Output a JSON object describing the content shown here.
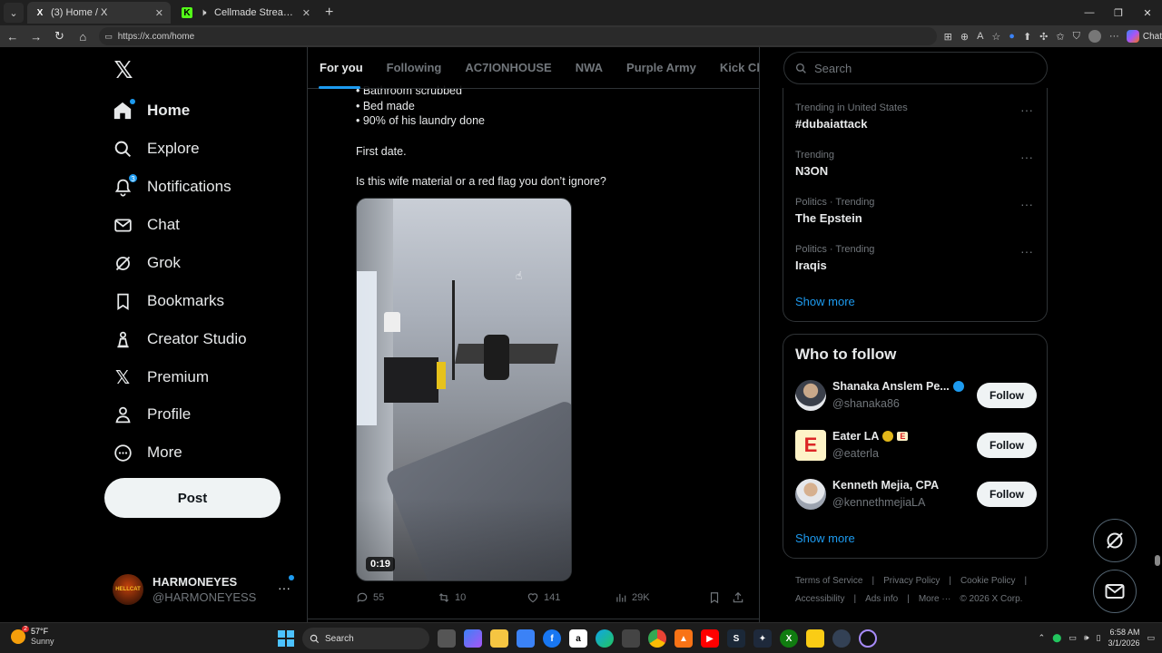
{
  "browser": {
    "tabs": [
      {
        "title": "(3) Home / X",
        "favicon": "X",
        "active": true
      },
      {
        "title": "Cellmade Stream - Watch Liv",
        "favicon": "K",
        "active": false
      }
    ],
    "url": "https://x.com/home",
    "chat_label": "Chat"
  },
  "sidebar": {
    "items": [
      {
        "label": "Home",
        "icon": "home-icon"
      },
      {
        "label": "Explore",
        "icon": "search-icon"
      },
      {
        "label": "Notifications",
        "icon": "bell-icon",
        "badge": "3"
      },
      {
        "label": "Chat",
        "icon": "mail-icon"
      },
      {
        "label": "Grok",
        "icon": "grok-icon"
      },
      {
        "label": "Bookmarks",
        "icon": "bookmark-icon"
      },
      {
        "label": "Creator Studio",
        "icon": "creator-studio-icon"
      },
      {
        "label": "Premium",
        "icon": "x-premium-icon"
      },
      {
        "label": "Profile",
        "icon": "person-icon"
      },
      {
        "label": "More",
        "icon": "more-circle-icon"
      }
    ],
    "post_label": "Post",
    "account": {
      "name": "HARMONEYES",
      "handle": "@HARMONEYESS",
      "avatar_text": "HELLCAT"
    }
  },
  "feed": {
    "tabs": [
      "For you",
      "Following",
      "AC7IONHOUSE",
      "NWA",
      "Purple Army",
      "Kick Clips"
    ],
    "post": {
      "lines": [
        "• Bathroom scrubbed",
        "• Bed made",
        "• 90% of his laundry done"
      ],
      "para1": "First date.",
      "para2": "Is this wife material or a red flag you don’t ignore?",
      "video_duration": "0:19",
      "replies": "55",
      "reposts": "10",
      "likes": "141",
      "views": "29K"
    }
  },
  "right": {
    "search_placeholder": "Search",
    "trends": [
      {
        "context": "Trending in United States",
        "title": "#dubaiattack"
      },
      {
        "context": "Trending",
        "title": "N3ON"
      },
      {
        "context": "Politics · Trending",
        "title": "The Epstein"
      },
      {
        "context": "Politics · Trending",
        "title": "Iraqis"
      }
    ],
    "trends_show_more": "Show more",
    "who_to_follow": {
      "title": "Who to follow",
      "accounts": [
        {
          "name": "Shanaka Anslem Pe...",
          "handle": "@shanaka86",
          "verified": "blue"
        },
        {
          "name": "Eater LA",
          "handle": "@eaterla",
          "verified": "gold",
          "affiliate": "E"
        },
        {
          "name": "Kenneth Mejia, CPA",
          "handle": "@kennethmejiaLA",
          "verified": "none"
        }
      ],
      "follow_label": "Follow",
      "show_more": "Show more"
    },
    "footer": [
      "Terms of Service",
      "|",
      "Privacy Policy",
      "|",
      "Cookie Policy",
      "|",
      "Accessibility",
      "|",
      "Ads info",
      "|",
      "More ···",
      "© 2026 X Corp."
    ]
  },
  "taskbar": {
    "weather_temp": "57°F",
    "weather_desc": "Sunny",
    "weather_badge": "2",
    "search_label": "Search",
    "time": "6:58 AM",
    "date": "3/1/2026"
  },
  "colors": {
    "accent": "#1d9bf0",
    "background": "#000000",
    "text": "#e7e9ea",
    "muted": "#71767b"
  }
}
